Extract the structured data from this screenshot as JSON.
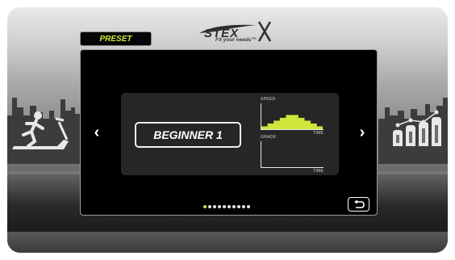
{
  "header": {
    "preset_tab_label": "PRESET",
    "brand_logo": "STEX",
    "brand_tagline": "Fit your needs™"
  },
  "program_selector": {
    "selected_program": "BEGINNER 1",
    "prev_icon": "chevron-left-icon",
    "next_icon": "chevron-right-icon",
    "speed_label": "SPEED",
    "grade_label": "GRADE",
    "speed_axis_label": "TIME",
    "grade_axis_label": "TIME",
    "speed_profile_color": "#cfe63a",
    "speed_profile": [
      1,
      2,
      3,
      4,
      5,
      5,
      4,
      3,
      2,
      1
    ],
    "grade_profile": [
      0,
      0,
      0,
      0,
      0,
      0,
      0,
      0,
      0,
      0
    ]
  },
  "pagination": {
    "total": 10,
    "active_index": 0
  },
  "footer": {
    "back_icon": "return-icon"
  },
  "decor": {
    "left_icon": "treadmill-runner-icon",
    "right_icon": "bar-chart-icon",
    "accent_color": "#cfe63a"
  }
}
